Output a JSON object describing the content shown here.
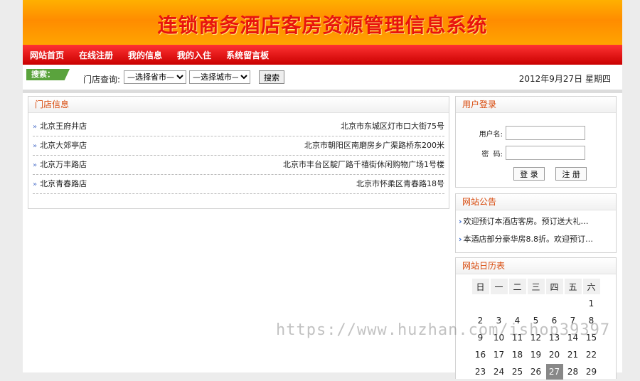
{
  "banner": {
    "title": "连锁商务酒店客房资源管理信息系统"
  },
  "nav": [
    "网站首页",
    "在线注册",
    "我的信息",
    "我的入住",
    "系统留言板"
  ],
  "search": {
    "tag": "搜索：",
    "label": "门店查询:",
    "province_select": "—选择省市—",
    "city_select": "—选择城市—",
    "button": "搜索",
    "date": "2012年9月27日  星期四"
  },
  "stores": {
    "title": "门店信息",
    "items": [
      {
        "name": "北京王府井店",
        "address": "北京市东城区灯市口大街75号"
      },
      {
        "name": "北京大郊亭店",
        "address": "北京市朝阳区南磨房乡广渠路桥东200米"
      },
      {
        "name": "北京万丰路店",
        "address": "北京市丰台区靛厂路千禧街休闲购物广场1号楼"
      },
      {
        "name": "北京青春路店",
        "address": "北京市怀柔区青春路18号"
      }
    ]
  },
  "login": {
    "title": "用户登录",
    "username_label": "用户名:",
    "password_label": "密  码:",
    "login_button": "登 录",
    "register_button": "注 册"
  },
  "notices": {
    "title": "网站公告",
    "items": [
      "欢迎预订本酒店客房。预订送大礼…",
      "本酒店部分豪华房8.8折。欢迎预订…"
    ]
  },
  "calendar": {
    "title": "网站日历表",
    "weekdays": [
      "日",
      "一",
      "二",
      "三",
      "四",
      "五",
      "六"
    ],
    "rows": [
      [
        "",
        "",
        "",
        "",
        "",
        "",
        "1"
      ],
      [
        "2",
        "3",
        "4",
        "5",
        "6",
        "7",
        "8"
      ],
      [
        "9",
        "10",
        "11",
        "12",
        "13",
        "14",
        "15"
      ],
      [
        "16",
        "17",
        "18",
        "19",
        "20",
        "21",
        "22"
      ],
      [
        "23",
        "24",
        "25",
        "26",
        "27",
        "28",
        "29"
      ]
    ],
    "today": "27"
  },
  "watermark": "https://www.huzhan.com/ishop39397"
}
